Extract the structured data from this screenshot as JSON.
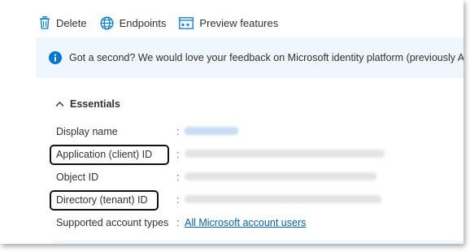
{
  "toolbar": {
    "delete_label": "Delete",
    "endpoints_label": "Endpoints",
    "preview_label": "Preview features"
  },
  "banner": {
    "text": "Got a second? We would love your feedback on Microsoft identity platform (previously Azur"
  },
  "essentials": {
    "title": "Essentials",
    "rows": [
      {
        "label": "Display name",
        "value": ""
      },
      {
        "label": "Application (client) ID",
        "value": ""
      },
      {
        "label": "Object ID",
        "value": ""
      },
      {
        "label": "Directory (tenant) ID",
        "value": ""
      },
      {
        "label": "Supported account types",
        "value": "All Microsoft account users"
      }
    ],
    "colon": ":"
  },
  "colors": {
    "accent": "#0078d4",
    "banner_bg": "#eff6fc",
    "link": "#0062ad"
  },
  "icons": {
    "delete": "trash-icon",
    "endpoints": "globe-icon",
    "preview": "preview-features-icon",
    "info": "info-icon",
    "toggle": "chevron-up-icon"
  }
}
